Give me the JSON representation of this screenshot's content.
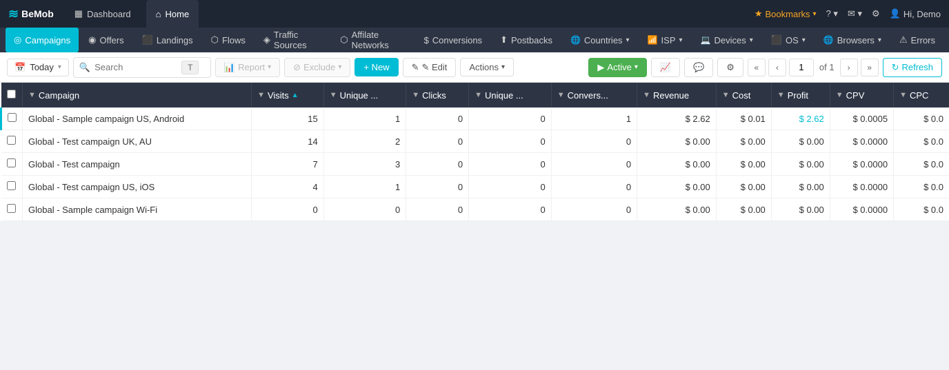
{
  "app": {
    "logo": "BeMob",
    "logo_icon": "≋"
  },
  "top_nav": {
    "tabs": [
      {
        "id": "dashboard",
        "label": "Dashboard",
        "icon": "▦",
        "active": false
      },
      {
        "id": "home",
        "label": "Home",
        "icon": "⌂",
        "active": true
      }
    ],
    "right": {
      "bookmarks_label": "Bookmarks",
      "help_label": "?",
      "inbox_icon": "✉",
      "settings_icon": "⚙",
      "user_label": "Hi, Demo"
    }
  },
  "second_nav": {
    "items": [
      {
        "id": "campaigns",
        "label": "Campaigns",
        "icon": "◎",
        "active": true,
        "has_arrow": false
      },
      {
        "id": "offers",
        "label": "Offers",
        "icon": "◉",
        "active": false,
        "has_arrow": false
      },
      {
        "id": "landings",
        "label": "Landings",
        "icon": "⬛",
        "active": false,
        "has_arrow": false
      },
      {
        "id": "flows",
        "label": "Flows",
        "icon": "⬡",
        "active": false,
        "has_arrow": false
      },
      {
        "id": "traffic-sources",
        "label": "Traffic Sources",
        "icon": "◈",
        "active": false,
        "has_arrow": false
      },
      {
        "id": "affiliate-networks",
        "label": "Affilate Networks",
        "icon": "⬡",
        "active": false,
        "has_arrow": false
      },
      {
        "id": "conversions",
        "label": "Conversions",
        "icon": "$",
        "active": false,
        "has_arrow": false
      },
      {
        "id": "postbacks",
        "label": "Postbacks",
        "icon": "⬆",
        "active": false,
        "has_arrow": false
      },
      {
        "id": "countries",
        "label": "Countries",
        "icon": "🌐",
        "active": false,
        "has_arrow": true
      },
      {
        "id": "isp",
        "label": "ISP",
        "icon": "📶",
        "active": false,
        "has_arrow": true
      },
      {
        "id": "devices",
        "label": "Devices",
        "icon": "💻",
        "active": false,
        "has_arrow": true
      },
      {
        "id": "os",
        "label": "OS",
        "icon": "⬛",
        "active": false,
        "has_arrow": true
      },
      {
        "id": "browsers",
        "label": "Browsers",
        "icon": "🌐",
        "active": false,
        "has_arrow": true
      },
      {
        "id": "errors",
        "label": "Errors",
        "icon": "⚠",
        "active": false,
        "has_arrow": false
      }
    ]
  },
  "toolbar": {
    "date_label": "Today",
    "date_icon": "📅",
    "search_placeholder": "Search",
    "filter_label": "T",
    "report_label": "Report",
    "exclude_label": "Exclude",
    "new_label": "+ New",
    "edit_label": "✎ Edit",
    "actions_label": "Actions",
    "active_label": "Active",
    "page_current": "1",
    "page_total": "of 1",
    "refresh_label": "Refresh"
  },
  "table": {
    "columns": [
      {
        "id": "campaign",
        "label": "Campaign",
        "sortable": true,
        "sorted": false
      },
      {
        "id": "visits",
        "label": "Visits",
        "sortable": true,
        "sorted": true
      },
      {
        "id": "unique1",
        "label": "Unique ...",
        "sortable": true,
        "sorted": false
      },
      {
        "id": "clicks",
        "label": "Clicks",
        "sortable": true,
        "sorted": false
      },
      {
        "id": "unique2",
        "label": "Unique ...",
        "sortable": true,
        "sorted": false
      },
      {
        "id": "conversions",
        "label": "Convers...",
        "sortable": true,
        "sorted": false
      },
      {
        "id": "revenue",
        "label": "Revenue",
        "sortable": true,
        "sorted": false
      },
      {
        "id": "cost",
        "label": "Cost",
        "sortable": true,
        "sorted": false
      },
      {
        "id": "profit",
        "label": "Profit",
        "sortable": true,
        "sorted": false
      },
      {
        "id": "cpv",
        "label": "CPV",
        "sortable": true,
        "sorted": false
      },
      {
        "id": "cpc",
        "label": "CPC",
        "sortable": true,
        "sorted": false
      }
    ],
    "rows": [
      {
        "id": 1,
        "campaign": "Global - Sample campaign US, Android",
        "visits": "15",
        "unique1": "1",
        "clicks": "0",
        "unique2": "0",
        "conversions": "1",
        "revenue": "$ 2.62",
        "cost": "$ 0.01",
        "profit": "$ 2.62",
        "cpv": "$ 0.0005",
        "cpc": "$ 0.0",
        "profit_highlight": true
      },
      {
        "id": 2,
        "campaign": "Global - Test campaign UK, AU",
        "visits": "14",
        "unique1": "2",
        "clicks": "0",
        "unique2": "0",
        "conversions": "0",
        "revenue": "$ 0.00",
        "cost": "$ 0.00",
        "profit": "$ 0.00",
        "cpv": "$ 0.0000",
        "cpc": "$ 0.0",
        "profit_highlight": false
      },
      {
        "id": 3,
        "campaign": "Global - Test campaign",
        "visits": "7",
        "unique1": "3",
        "clicks": "0",
        "unique2": "0",
        "conversions": "0",
        "revenue": "$ 0.00",
        "cost": "$ 0.00",
        "profit": "$ 0.00",
        "cpv": "$ 0.0000",
        "cpc": "$ 0.0",
        "profit_highlight": false
      },
      {
        "id": 4,
        "campaign": "Global - Test campaign US, iOS",
        "visits": "4",
        "unique1": "1",
        "clicks": "0",
        "unique2": "0",
        "conversions": "0",
        "revenue": "$ 0.00",
        "cost": "$ 0.00",
        "profit": "$ 0.00",
        "cpv": "$ 0.0000",
        "cpc": "$ 0.0",
        "profit_highlight": false
      },
      {
        "id": 5,
        "campaign": "Global - Sample campaign Wi-Fi",
        "visits": "0",
        "unique1": "0",
        "clicks": "0",
        "unique2": "0",
        "conversions": "0",
        "revenue": "$ 0.00",
        "cost": "$ 0.00",
        "profit": "$ 0.00",
        "cpv": "$ 0.0000",
        "cpc": "$ 0.0",
        "profit_highlight": false
      }
    ]
  }
}
